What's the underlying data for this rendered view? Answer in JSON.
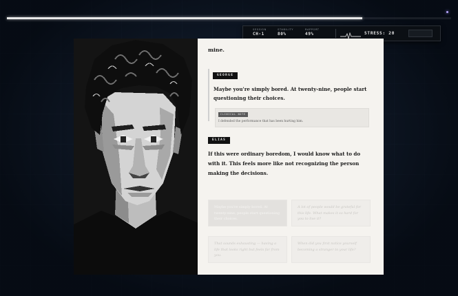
{
  "progress": {
    "fraction": 0.8
  },
  "hud": {
    "session_label": "SESSION",
    "session_value": "CH-1",
    "stability_label": "STABILITY",
    "stability_value": "80%",
    "rapport_label": "RAPPORT",
    "rapport_value": "49%",
    "stress_value": "STRESS: 20"
  },
  "dialogue": {
    "line_top": "mine.",
    "george": {
      "speaker": "GEORGE",
      "line": "Maybe you're simply bored. At twenty-nine, people start questioning their choices."
    },
    "clinical_note": {
      "label": "CLINICAL NOTE",
      "text": "I defended the performance that has been hurting him."
    },
    "elias": {
      "speaker": "ELIAS",
      "line": "If this were ordinary boredom, I would know what to do with it. This feels more like not recognizing the person making the decisions."
    }
  },
  "choices": [
    {
      "text": "Maybe you're simply bored. At twenty-nine, people start questioning their choices."
    },
    {
      "text": "A lot of people would be grateful for this life. What makes it so hard for you to live it?"
    },
    {
      "text": "That sounds exhausting — having a life that looks right but feels far from you."
    },
    {
      "text": "When did you first notice yourself becoming a stranger to your life?"
    }
  ],
  "colors": {
    "accent": "#111111",
    "panel": "#f5f3ef",
    "background": "#0d1522"
  },
  "icons": {
    "pulse": "heartbeat-icon"
  }
}
